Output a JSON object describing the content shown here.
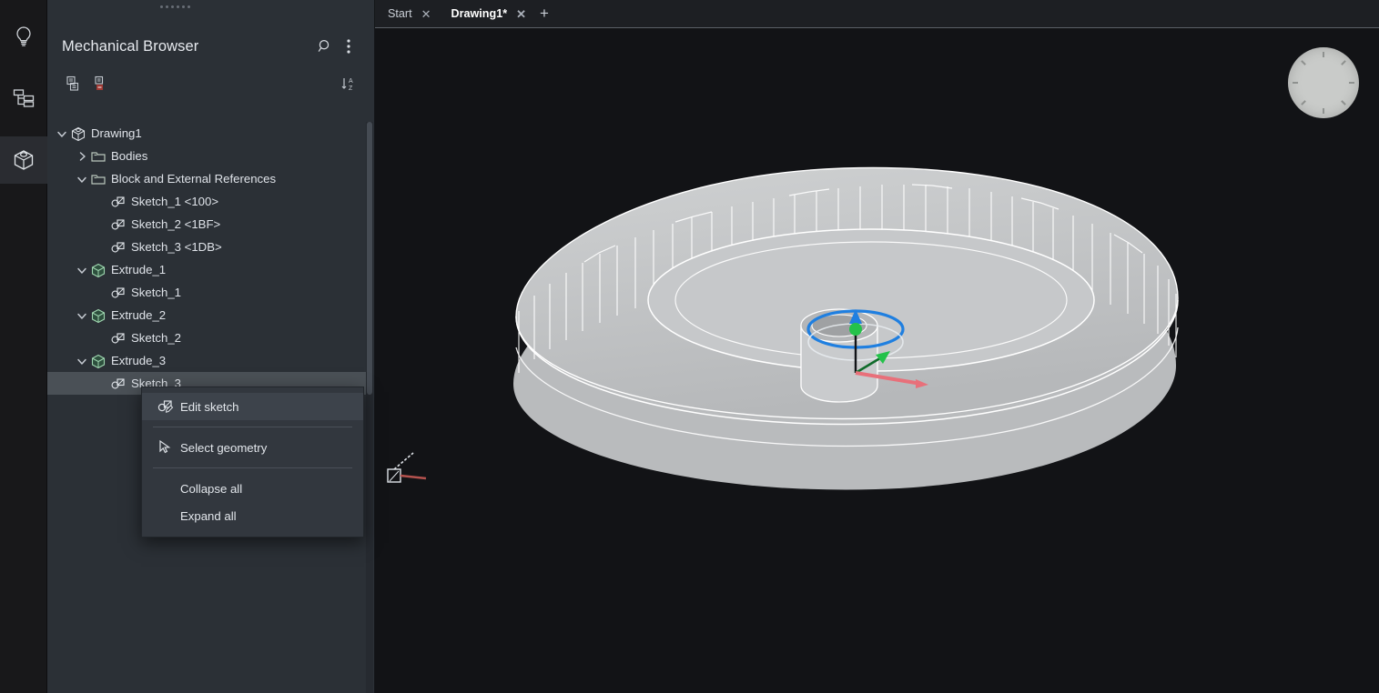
{
  "rail": {
    "items": [
      {
        "name": "lightbulb-icon",
        "label": "Lights",
        "active": false
      },
      {
        "name": "structure-tree-icon",
        "label": "Structure",
        "active": false
      },
      {
        "name": "cube-icon",
        "label": "Mechanical Browser",
        "active": true
      }
    ]
  },
  "panel": {
    "title": "Mechanical Browser",
    "search_icon": "search-icon",
    "overflow_icon": "more-vertical-icon",
    "tools": [
      {
        "name": "new-component-icon"
      },
      {
        "name": "delete-component-icon"
      },
      {
        "name": "sort-az-icon"
      }
    ]
  },
  "tree": [
    {
      "label": "Drawing1",
      "depth": 0,
      "twisty": "down",
      "icon": "drawing-cube-icon",
      "selected": false
    },
    {
      "label": "Bodies",
      "depth": 1,
      "twisty": "right",
      "icon": "folder-icon",
      "selected": false
    },
    {
      "label": "Block and External References",
      "depth": 1,
      "twisty": "down",
      "icon": "folder-icon",
      "selected": false
    },
    {
      "label": "Sketch_1 <100>",
      "depth": 2,
      "twisty": "none",
      "icon": "sketch-icon",
      "selected": false
    },
    {
      "label": "Sketch_2 <1BF>",
      "depth": 2,
      "twisty": "none",
      "icon": "sketch-icon",
      "selected": false
    },
    {
      "label": "Sketch_3 <1DB>",
      "depth": 2,
      "twisty": "none",
      "icon": "sketch-icon",
      "selected": false
    },
    {
      "label": "Extrude_1",
      "depth": 1,
      "twisty": "down",
      "icon": "extrude-icon",
      "selected": false
    },
    {
      "label": "Sketch_1",
      "depth": 2,
      "twisty": "none",
      "icon": "sketch-icon",
      "selected": false
    },
    {
      "label": "Extrude_2",
      "depth": 1,
      "twisty": "down",
      "icon": "extrude-icon",
      "selected": false
    },
    {
      "label": "Sketch_2",
      "depth": 2,
      "twisty": "none",
      "icon": "sketch-icon",
      "selected": false
    },
    {
      "label": "Extrude_3",
      "depth": 1,
      "twisty": "down",
      "icon": "extrude-icon",
      "selected": false
    },
    {
      "label": "Sketch_3",
      "depth": 2,
      "twisty": "none",
      "icon": "sketch-icon",
      "selected": true
    }
  ],
  "context_menu": [
    {
      "label": "Edit sketch",
      "icon": "edit-sketch-icon",
      "highlighted": true,
      "separator_after": true
    },
    {
      "label": "Select geometry",
      "icon": "cursor-arrow-icon",
      "highlighted": false,
      "separator_after": true
    },
    {
      "label": "Collapse all",
      "icon": "none",
      "highlighted": false,
      "separator_after": false
    },
    {
      "label": "Expand all",
      "icon": "none",
      "highlighted": false,
      "separator_after": false
    }
  ],
  "tabs": {
    "items": [
      {
        "label": "Start",
        "active": false,
        "closable": true
      },
      {
        "label": "Drawing1*",
        "active": true,
        "closable": true
      }
    ],
    "add_label": "+"
  },
  "viewport": {
    "nav_widget": "view-compass-widget",
    "ucs_icon": "ucs-axis-icon",
    "gizmo": "rotate-move-gizmo",
    "model": "gear-solid-model"
  },
  "colors": {
    "panel_bg": "#2b3036",
    "rail_bg": "#18181a",
    "viewport_bg": "#121316",
    "selection": "#4a5056",
    "menu_bg": "#32373e",
    "accent_red": "#c0392b",
    "gizmo_blue": "#1f7fe0",
    "gizmo_green": "#24c24a",
    "gizmo_red": "#e8707a",
    "model_face": "#c4c6c8"
  }
}
